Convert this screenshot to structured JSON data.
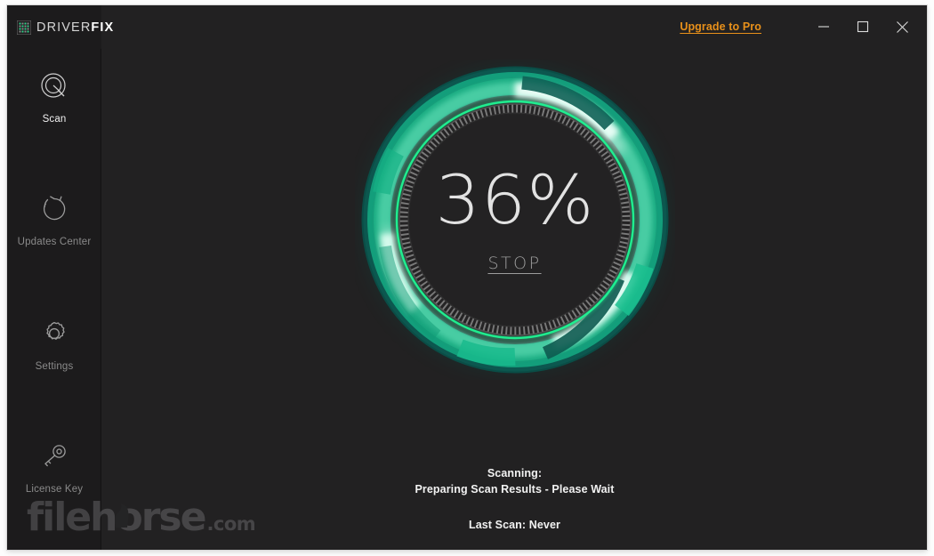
{
  "app": {
    "name_light": "DRIVER",
    "name_bold": "FIX",
    "logo_icon": "pixel-grid-icon"
  },
  "titlebar": {
    "upgrade_label": "Upgrade to Pro",
    "minimize_icon": "minimize-icon",
    "maximize_icon": "maximize-icon",
    "close_icon": "close-icon"
  },
  "sidebar": {
    "items": [
      {
        "id": "scan",
        "label": "Scan",
        "icon": "scan-magnifier-icon",
        "active": true
      },
      {
        "id": "updates",
        "label": "Updates Center",
        "icon": "refresh-circle-icon",
        "active": false
      },
      {
        "id": "settings",
        "label": "Settings",
        "icon": "gear-icon",
        "active": false
      },
      {
        "id": "license",
        "label": "License Key",
        "icon": "key-icon",
        "active": false
      }
    ]
  },
  "scan": {
    "percent_label": "36%",
    "percent_value": 36,
    "stop_label": "STOP",
    "status_title": "Scanning:",
    "status_detail": "Preparing Scan Results - Please Wait",
    "last_scan": "Last Scan: Never"
  },
  "watermark": {
    "name": "filehorse",
    "tld": ".com"
  },
  "colors": {
    "window_bg": "#222122",
    "sidebar_bg": "#1c1b1c",
    "accent_orange": "#e8901a",
    "ring_dark_teal": "#0c4a43",
    "ring_teal": "#14a882",
    "ring_mint": "#4fe0b0",
    "ring_bright": "#d9fff0",
    "ring_green_edge": "#12f08a",
    "text_primary": "#f2f2f2",
    "text_muted": "#8a8a8a"
  }
}
